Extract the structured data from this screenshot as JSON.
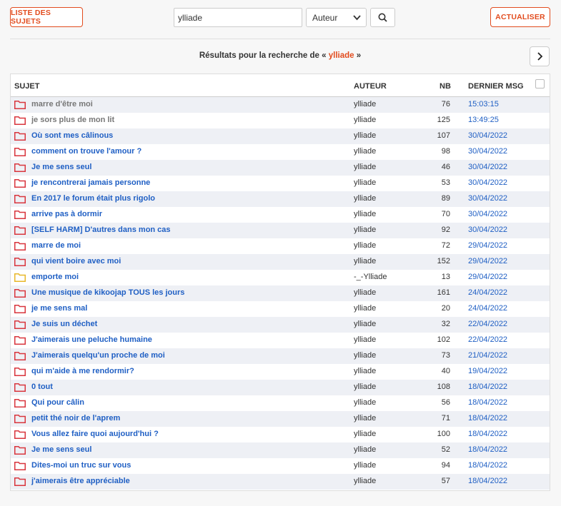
{
  "toolbar": {
    "list_label": "Liste des sujets",
    "search_value": "ylliade",
    "search_type": "Auteur",
    "refresh_label": "Actualiser"
  },
  "results": {
    "prefix": "Résultats pour la recherche de « ",
    "query": "ylliade",
    "suffix": " »"
  },
  "table": {
    "headers": {
      "subject": "Sujet",
      "author": "Auteur",
      "nb": "NB",
      "date": "Dernier msg"
    },
    "rows": [
      {
        "subject": "marre d'être moi",
        "author": "ylliade",
        "nb": "76",
        "date": "15:03:15",
        "read": true,
        "folder": "red"
      },
      {
        "subject": "je sors plus de mon lit",
        "author": "ylliade",
        "nb": "125",
        "date": "13:49:25",
        "read": true,
        "folder": "red"
      },
      {
        "subject": "Où sont mes câlinous",
        "author": "ylliade",
        "nb": "107",
        "date": "30/04/2022",
        "read": false,
        "folder": "red"
      },
      {
        "subject": "comment on trouve l'amour ?",
        "author": "ylliade",
        "nb": "98",
        "date": "30/04/2022",
        "read": false,
        "folder": "red"
      },
      {
        "subject": "Je me sens seul",
        "author": "ylliade",
        "nb": "46",
        "date": "30/04/2022",
        "read": false,
        "folder": "red"
      },
      {
        "subject": "je rencontrerai jamais personne",
        "author": "ylliade",
        "nb": "53",
        "date": "30/04/2022",
        "read": false,
        "folder": "red"
      },
      {
        "subject": "En 2017 le forum était plus rigolo",
        "author": "ylliade",
        "nb": "89",
        "date": "30/04/2022",
        "read": false,
        "folder": "red"
      },
      {
        "subject": "arrive pas à dormir",
        "author": "ylliade",
        "nb": "70",
        "date": "30/04/2022",
        "read": false,
        "folder": "red"
      },
      {
        "subject": "[SELF HARM] D'autres dans mon cas",
        "author": "ylliade",
        "nb": "92",
        "date": "30/04/2022",
        "read": false,
        "folder": "red"
      },
      {
        "subject": "marre de moi",
        "author": "ylliade",
        "nb": "72",
        "date": "29/04/2022",
        "read": false,
        "folder": "red"
      },
      {
        "subject": "qui vient boire avec moi",
        "author": "ylliade",
        "nb": "152",
        "date": "29/04/2022",
        "read": false,
        "folder": "red"
      },
      {
        "subject": "emporte moi",
        "author": "-_-Ylliade",
        "nb": "13",
        "date": "29/04/2022",
        "read": false,
        "folder": "yellow"
      },
      {
        "subject": "Une musique de kikoojap TOUS les jours",
        "author": "ylliade",
        "nb": "161",
        "date": "24/04/2022",
        "read": false,
        "folder": "red"
      },
      {
        "subject": "je me sens mal",
        "author": "ylliade",
        "nb": "20",
        "date": "24/04/2022",
        "read": false,
        "folder": "red"
      },
      {
        "subject": "Je suis un déchet",
        "author": "ylliade",
        "nb": "32",
        "date": "22/04/2022",
        "read": false,
        "folder": "red"
      },
      {
        "subject": "J'aimerais une peluche humaine",
        "author": "ylliade",
        "nb": "102",
        "date": "22/04/2022",
        "read": false,
        "folder": "red"
      },
      {
        "subject": "J'aimerais quelqu'un proche de moi",
        "author": "ylliade",
        "nb": "73",
        "date": "21/04/2022",
        "read": false,
        "folder": "red"
      },
      {
        "subject": "qui m'aide à me rendormir?",
        "author": "ylliade",
        "nb": "40",
        "date": "19/04/2022",
        "read": false,
        "folder": "red"
      },
      {
        "subject": "0 tout",
        "author": "ylliade",
        "nb": "108",
        "date": "18/04/2022",
        "read": false,
        "folder": "red"
      },
      {
        "subject": "Qui pour câlin",
        "author": "ylliade",
        "nb": "56",
        "date": "18/04/2022",
        "read": false,
        "folder": "red"
      },
      {
        "subject": "petit thé noir de l'aprem",
        "author": "ylliade",
        "nb": "71",
        "date": "18/04/2022",
        "read": false,
        "folder": "red"
      },
      {
        "subject": "Vous allez faire quoi aujourd'hui ?",
        "author": "ylliade",
        "nb": "100",
        "date": "18/04/2022",
        "read": false,
        "folder": "red"
      },
      {
        "subject": "Je me sens seul",
        "author": "ylliade",
        "nb": "52",
        "date": "18/04/2022",
        "read": false,
        "folder": "red"
      },
      {
        "subject": "Dites-moi un truc sur vous",
        "author": "ylliade",
        "nb": "94",
        "date": "18/04/2022",
        "read": false,
        "folder": "red"
      },
      {
        "subject": "j'aimerais être appréciable",
        "author": "ylliade",
        "nb": "57",
        "date": "18/04/2022",
        "read": false,
        "folder": "red"
      }
    ]
  },
  "colors": {
    "accent": "#e24c1e",
    "link": "#1f5fc4",
    "folder_red": "#d9363e",
    "folder_yellow": "#e8b82a"
  },
  "icons": {
    "search": "search-icon",
    "next": "chevron-right-icon",
    "folder": "folder-icon",
    "dropdown": "chevron-down-icon"
  }
}
